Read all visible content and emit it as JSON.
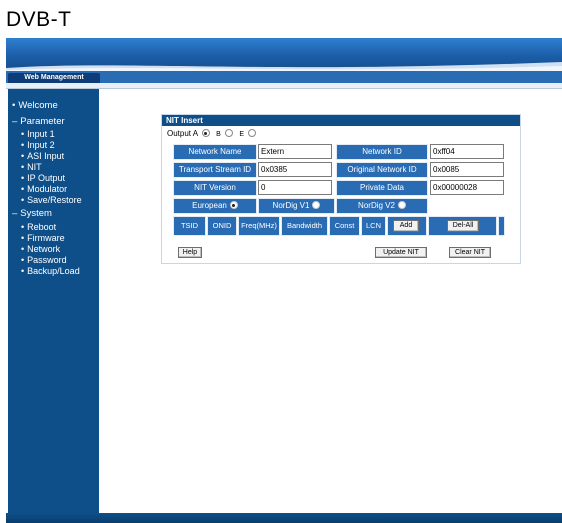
{
  "page_title": "DVB-T",
  "header": {
    "tab_label": "Web Management"
  },
  "sidebar": {
    "items": [
      {
        "label": "Welcome",
        "level": 1
      },
      {
        "label": "Parameter",
        "level": 1
      },
      {
        "label": "Input 1",
        "level": 2
      },
      {
        "label": "Input 2",
        "level": 2
      },
      {
        "label": "ASI Input",
        "level": 2
      },
      {
        "label": "NIT",
        "level": 2
      },
      {
        "label": "IP Output",
        "level": 2
      },
      {
        "label": "Modulator",
        "level": 2
      },
      {
        "label": "Save/Restore",
        "level": 2
      },
      {
        "label": "System",
        "level": 1
      },
      {
        "label": "Reboot",
        "level": 2
      },
      {
        "label": "Firmware",
        "level": 2
      },
      {
        "label": "Network",
        "level": 2
      },
      {
        "label": "Password",
        "level": 2
      },
      {
        "label": "Backup/Load",
        "level": 2
      }
    ]
  },
  "panel": {
    "title": "NIT Insert",
    "output": {
      "label": "Output A",
      "options": [
        "B",
        "E"
      ],
      "selected": "A"
    },
    "fields": {
      "network_name": {
        "label": "Network Name",
        "value": "Extern"
      },
      "network_id": {
        "label": "Network ID",
        "value": "0xff04"
      },
      "transport_stream_id": {
        "label": "Transport Stream ID",
        "value": "0x0385"
      },
      "original_network_id": {
        "label": "Original Network ID",
        "value": "0x0085"
      },
      "nit_version": {
        "label": "NIT Version",
        "value": "0"
      },
      "private_data": {
        "label": "Private Data",
        "value": "0x00000028"
      }
    },
    "standards": {
      "options": [
        "European",
        "NorDig V1",
        "NorDig V2"
      ],
      "selected": "European"
    },
    "table": {
      "columns": [
        "TSID",
        "ONID",
        "Freq(MHz)",
        "Bandwidth",
        "Const",
        "LCN"
      ],
      "add_label": "Add",
      "del_all_label": "Del-All"
    },
    "buttons": {
      "help": "Help",
      "update_nit": "Update NIT",
      "clear_nit": "Clear NIT"
    }
  },
  "colors": {
    "brand_dark": "#0e4f8a",
    "brand_mid": "#2a6cb4",
    "banner_light": "#2f7fd0"
  }
}
